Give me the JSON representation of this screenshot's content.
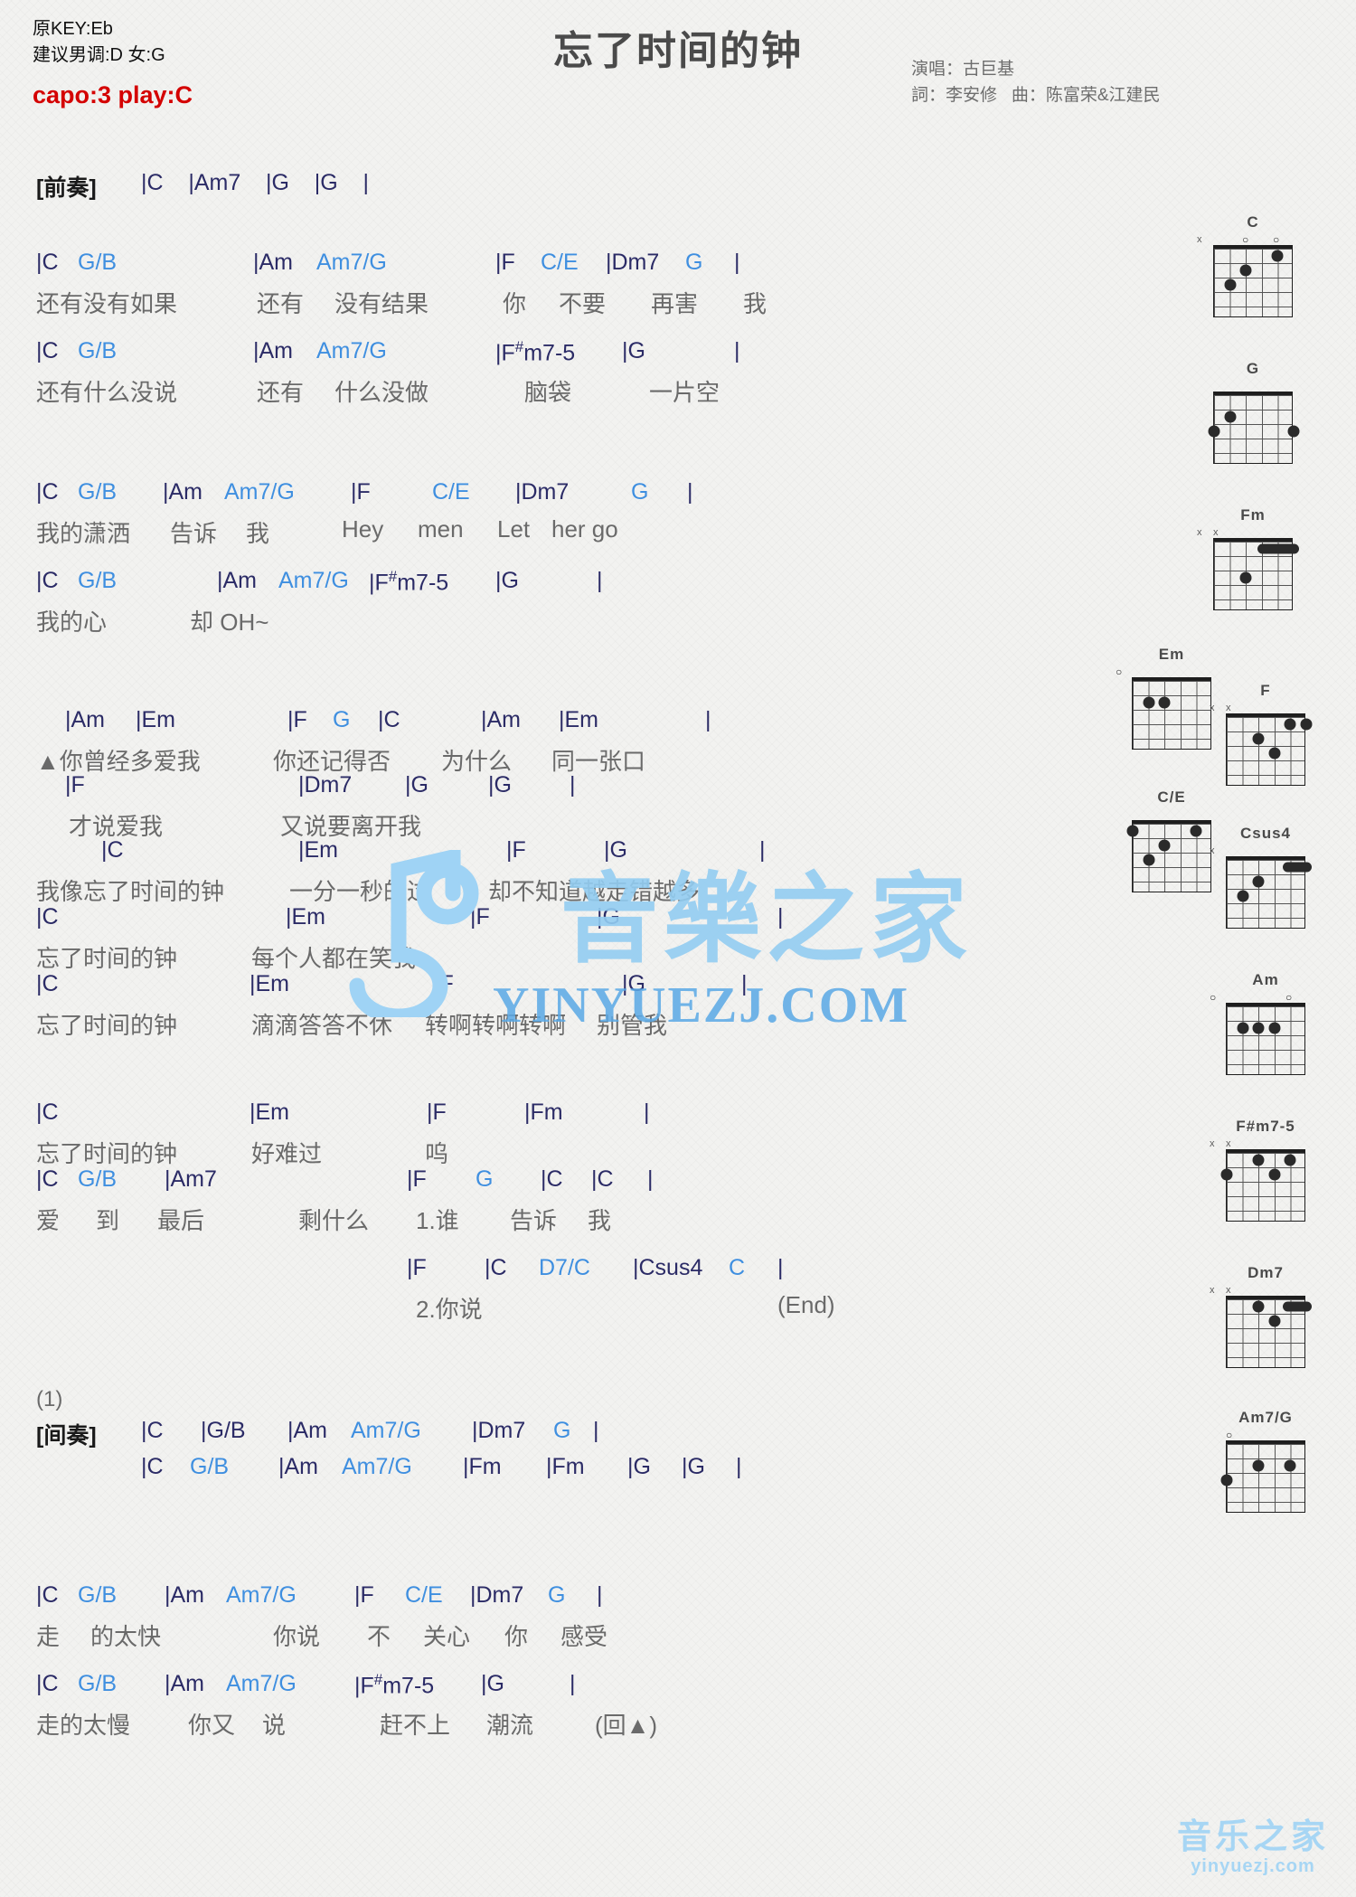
{
  "header": {
    "orig_key": "原KEY:Eb",
    "suggest_key": "建议男调:D 女:G",
    "capo": "capo:3 play:C",
    "title": "忘了时间的钟",
    "singer": "演唱：古巨基",
    "writers": "詞：李安修   曲：陈富荣&江建民",
    "accent_chord": "#3f8fe0",
    "accent_capo": "#d40000"
  },
  "sections": {
    "intro_label": "[前奏]",
    "interlude_label": "[间奏]",
    "repeat_marker": "▲",
    "end_marker": "(End)",
    "return_marker": "(回▲)",
    "para_one": "(1)",
    "ending_one": "1.谁",
    "ending_two": "2.你说"
  },
  "lines": {
    "intro": {
      "chords": "|C    |Am7    |G    |G    |"
    },
    "v1a": {
      "chords": [
        "|C",
        "G/B",
        "|Am",
        "Am7/G",
        "|F",
        "C/E",
        "|Dm7",
        "G",
        "|"
      ],
      "lyrics": [
        "还有没有如果",
        "还有",
        "没有结果",
        "你",
        "不要",
        "再害",
        "我"
      ]
    },
    "v1b": {
      "chords": [
        "|C",
        "G/B",
        "|Am",
        "Am7/G",
        "|F#m7-5",
        "|G",
        "|"
      ],
      "lyrics": [
        "还有什么没说",
        "还有",
        "什么没做",
        "脑袋",
        "一片空"
      ]
    },
    "v2a": {
      "chords": [
        "|C",
        "G/B",
        "|Am",
        "Am7/G",
        "|F",
        "C/E",
        "|Dm7",
        "G",
        "|"
      ],
      "lyrics": [
        "我的潇洒",
        "告诉",
        "我",
        "Hey",
        "men",
        "Let",
        "her go"
      ]
    },
    "v2b": {
      "chords": [
        "|C",
        "G/B",
        "|Am",
        "Am7/G",
        "|F#m7-5",
        "|G",
        "|"
      ],
      "lyrics": [
        "我的心",
        "却 OH~"
      ]
    },
    "c1": {
      "chords": [
        "|Am",
        "|Em",
        "|F",
        "G",
        "|C",
        "|Am",
        "|Em",
        "|"
      ],
      "lyrics": [
        "▲你曾经多爱我",
        "你还记得否",
        "为什么",
        "同一张口"
      ]
    },
    "c2": {
      "chords": [
        "|F",
        "|Dm7",
        "|G",
        "|G",
        "|"
      ],
      "lyrics": [
        "才说爱我",
        "又说要离开我"
      ]
    },
    "c3": {
      "chords": [
        "|C",
        "|Em",
        "|F",
        "|G",
        "|"
      ],
      "lyrics": [
        "我像忘了时间的钟",
        "一分一秒的过",
        "却不知道越走错越多"
      ]
    },
    "c4": {
      "chords": [
        "|C",
        "|Em",
        "|F",
        "|G",
        "|"
      ],
      "lyrics": [
        "忘了时间的钟",
        "每个人都在笑我"
      ]
    },
    "c5": {
      "chords": [
        "|C",
        "|Em",
        "|F",
        "|G",
        "|"
      ],
      "lyrics": [
        "忘了时间的钟",
        "滴滴答答不休",
        "转啊转啊转啊",
        "别管我"
      ]
    },
    "c6": {
      "chords": [
        "|C",
        "|Em",
        "|F",
        "|Fm",
        "|"
      ],
      "lyrics": [
        "忘了时间的钟",
        "好难过",
        "呜"
      ]
    },
    "c7": {
      "chords": [
        "|C",
        "G/B",
        "|Am7",
        "|F",
        "G",
        "|C",
        "|C",
        "|"
      ],
      "lyrics": [
        "爱",
        "到",
        "最后",
        "剩什么",
        "1.谁",
        "告诉",
        "我"
      ]
    },
    "c8": {
      "chords": [
        "|F",
        "|C",
        "D7/C",
        "|Csus4",
        "C",
        "|"
      ],
      "lyrics": [
        "2.你说",
        "(End)"
      ]
    },
    "int1": {
      "chords": [
        "|C",
        "|G/B",
        "|Am",
        "Am7/G",
        "|Dm7",
        "G",
        "|"
      ]
    },
    "int2": {
      "chords": [
        "|C",
        "G/B",
        "|Am",
        "Am7/G",
        "|Fm",
        "|Fm",
        "|G",
        "|G",
        "|"
      ]
    },
    "v3a": {
      "chords": [
        "|C",
        "G/B",
        "|Am",
        "Am7/G",
        "|F",
        "C/E",
        "|Dm7",
        "G",
        "|"
      ],
      "lyrics": [
        "走",
        "的太快",
        "你说",
        "不",
        "关心",
        "你",
        "感受"
      ]
    },
    "v3b": {
      "chords": [
        "|C",
        "G/B",
        "|Am",
        "Am7/G",
        "|F#m7-5",
        "|G",
        "|"
      ],
      "lyrics": [
        "走的太慢",
        "你又",
        "说",
        "赶不上",
        "潮流",
        "(回▲)"
      ]
    }
  },
  "chord_diagrams": [
    {
      "name": "C",
      "marks": "x  o o",
      "label_x": "x",
      "base": 1
    },
    {
      "name": "G",
      "marks": "",
      "base": 1
    },
    {
      "name": "Fm",
      "marks": "x x",
      "base": 1
    },
    {
      "name": "Em",
      "marks": "o   o o",
      "base": 1
    },
    {
      "name": "F",
      "marks": "x x",
      "base": 1
    },
    {
      "name": "C/E",
      "marks": "",
      "base": 1
    },
    {
      "name": "Csus4",
      "marks": "x",
      "base": 1
    },
    {
      "name": "Am",
      "marks": "o     o",
      "base": 1
    },
    {
      "name": "F#m7-5",
      "marks": "x x",
      "base": 1
    },
    {
      "name": "Dm7",
      "marks": "x x",
      "base": 1
    },
    {
      "name": "Am7/G",
      "marks": "o",
      "base": 1
    }
  ],
  "watermark": {
    "cn": "音樂之家",
    "en": "YINYUEZJ.COM",
    "corner_cn": "音乐之家",
    "corner_en": "yinyuezj.com"
  }
}
